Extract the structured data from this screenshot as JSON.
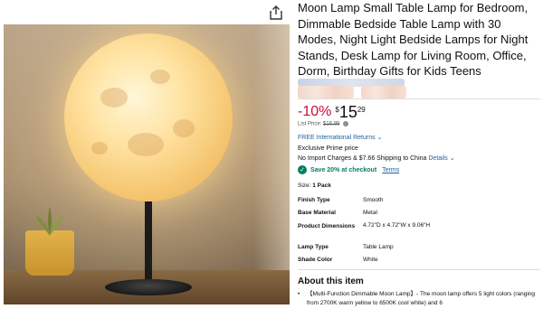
{
  "product": {
    "title": "Moon Lamp Small Table Lamp for Bedroom, Dimmable Bedside Table Lamp with 30 Modes, Night Light Bedside Lamps for Night Stands, Desk Lamp for Living Room, Office, Dorm, Birthday Gifts for Kids Teens",
    "share_icon": "share-icon"
  },
  "price": {
    "discount": "-10%",
    "currency": "$",
    "whole": "15",
    "fraction": "29",
    "list_price_label": "List Price:",
    "list_price_value": "$16.99"
  },
  "shipping": {
    "returns": "FREE International Returns",
    "prime": "Exclusive Prime price",
    "import_text": "No Import Charges & $7.66 Shipping to China",
    "details_link": "Details"
  },
  "promo": {
    "save_text": "Save 20% at checkout",
    "terms_link": "Terms"
  },
  "size": {
    "label": "Size:",
    "value": "1 Pack"
  },
  "specs": [
    {
      "key": "Finish Type",
      "value": "Smooth"
    },
    {
      "key": "Base Material",
      "value": "Metal"
    },
    {
      "key": "Product Dimensions",
      "value": "4.72\"D x 4.72\"W x 9.06\"H"
    },
    {
      "key": "Lamp Type",
      "value": "Table Lamp"
    },
    {
      "key": "Shade Color",
      "value": "White"
    }
  ],
  "about": {
    "heading": "About this item",
    "bullet_1": "【Multi-Function Dimmable Moon Lamp】- The moon lamp offers 5 light colors (ranging from 2700K warm yellow to 6500K cool white) and 6"
  },
  "colors": {
    "discount": "#cc0c39",
    "link": "#2162a1",
    "check": "#067d62"
  }
}
